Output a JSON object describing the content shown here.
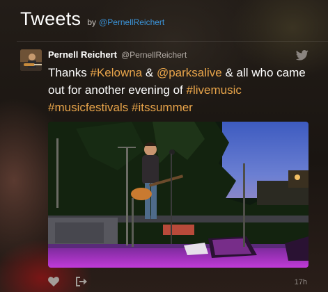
{
  "widget": {
    "title": "Tweets",
    "by_label": "by",
    "owner_handle": "@PernellReichert"
  },
  "tweet": {
    "author_name": "Pernell Reichert",
    "author_handle": "@PernellReichert",
    "text_segments": [
      {
        "text": "Thanks ",
        "link": false
      },
      {
        "text": "#Kelowna",
        "link": true
      },
      {
        "text": " & ",
        "link": false
      },
      {
        "text": "@parksalive",
        "link": true
      },
      {
        "text": " & all who came out for another evening of ",
        "link": false
      },
      {
        "text": "#livemusic",
        "link": true
      },
      {
        "text": " ",
        "link": false
      },
      {
        "text": "#musicfestivals",
        "link": true
      },
      {
        "text": " ",
        "link": false
      },
      {
        "text": "#itssummer",
        "link": true
      }
    ],
    "timestamp": "17h",
    "icons": {
      "platform": "twitter-bird-icon",
      "like": "heart-icon",
      "share": "share-icon"
    }
  },
  "colors": {
    "link": "#e8a44a",
    "handle_link": "#3b94d9",
    "text": "#ffffff",
    "muted": "#b4ada7"
  }
}
